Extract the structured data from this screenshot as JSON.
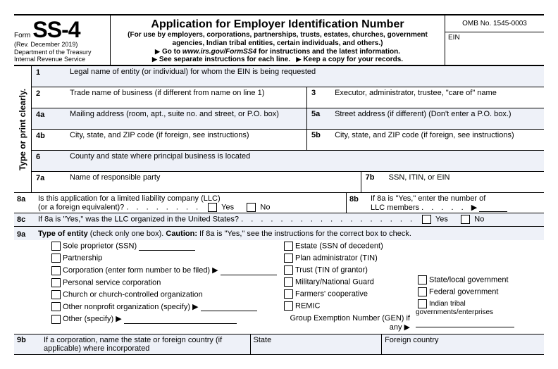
{
  "header": {
    "form_word": "Form",
    "form_number": "SS-4",
    "rev": "(Rev. December 2019)",
    "dept1": "Department of the Treasury",
    "dept2": "Internal Revenue Service",
    "title": "Application for Employer Identification Number",
    "subtitle": "(For use by employers, corporations, partnerships, trusts, estates, churches, government agencies, Indian tribal entities, certain individuals, and others.)",
    "goto_pre": "Go to ",
    "goto_url": "www.irs.gov/FormSS4",
    "goto_post": " for instructions and the latest information.",
    "see": "See separate instructions for each line.",
    "keep": "Keep a copy for your records.",
    "omb": "OMB No. 1545-0003",
    "ein": "EIN"
  },
  "sidebar": "Type or print clearly.",
  "l1": {
    "n": "1",
    "t": "Legal name of entity (or individual) for whom the EIN is being requested"
  },
  "l2": {
    "n": "2",
    "t": "Trade name of business (if different from name on line 1)"
  },
  "l3": {
    "n": "3",
    "t": "Executor, administrator, trustee, \"care of\" name"
  },
  "l4a": {
    "n": "4a",
    "t": "Mailing address (room, apt., suite no. and street, or P.O. box)"
  },
  "l5a": {
    "n": "5a",
    "t": "Street address (if different) (Don't enter a P.O. box.)"
  },
  "l4b": {
    "n": "4b",
    "t": "City, state, and ZIP code (if foreign, see instructions)"
  },
  "l5b": {
    "n": "5b",
    "t": "City, state, and ZIP code (if foreign, see instructions)"
  },
  "l6": {
    "n": "6",
    "t": "County and state where principal business is located"
  },
  "l7a": {
    "n": "7a",
    "t": "Name of responsible party"
  },
  "l7b": {
    "n": "7b",
    "t": "SSN, ITIN, or EIN"
  },
  "l8a": {
    "n": "8a",
    "t1": "Is this application for a limited liability company (LLC)",
    "t2": "(or a foreign equivalent)?",
    "yes": "Yes",
    "no": "No"
  },
  "l8b": {
    "n": "8b",
    "t1": "If 8a is \"Yes,\" enter the number of",
    "t2": "LLC members"
  },
  "l8c": {
    "n": "8c",
    "t": "If 8a is \"Yes,\" was the LLC organized in the United States?",
    "yes": "Yes",
    "no": "No"
  },
  "l9a": {
    "n": "9a",
    "head1": "Type of entity",
    "head2": " (check only one box). ",
    "caution": "Caution:",
    "head3": " If 8a is \"Yes,\" see the instructions for the correct box to check.",
    "c1": [
      "Sole proprietor (SSN)",
      "Partnership",
      "Corporation (enter form number to be filed)",
      "Personal service corporation",
      "Church or church-controlled organization",
      "Other nonprofit organization (specify)",
      "Other (specify)"
    ],
    "c2": [
      "Estate (SSN of decedent)",
      "Plan administrator (TIN)",
      "Trust (TIN of grantor)",
      "Military/National Guard",
      "Farmers' cooperative",
      "REMIC"
    ],
    "c3": [
      "State/local government",
      "Federal government",
      "Indian tribal governments/enterprises"
    ],
    "gen": "Group Exemption Number (GEN) if any"
  },
  "l9b": {
    "n": "9b",
    "t1": "If a corporation, name the state or foreign country (if",
    "t2": "applicable) where incorporated",
    "state": "State",
    "foreign": "Foreign country"
  }
}
